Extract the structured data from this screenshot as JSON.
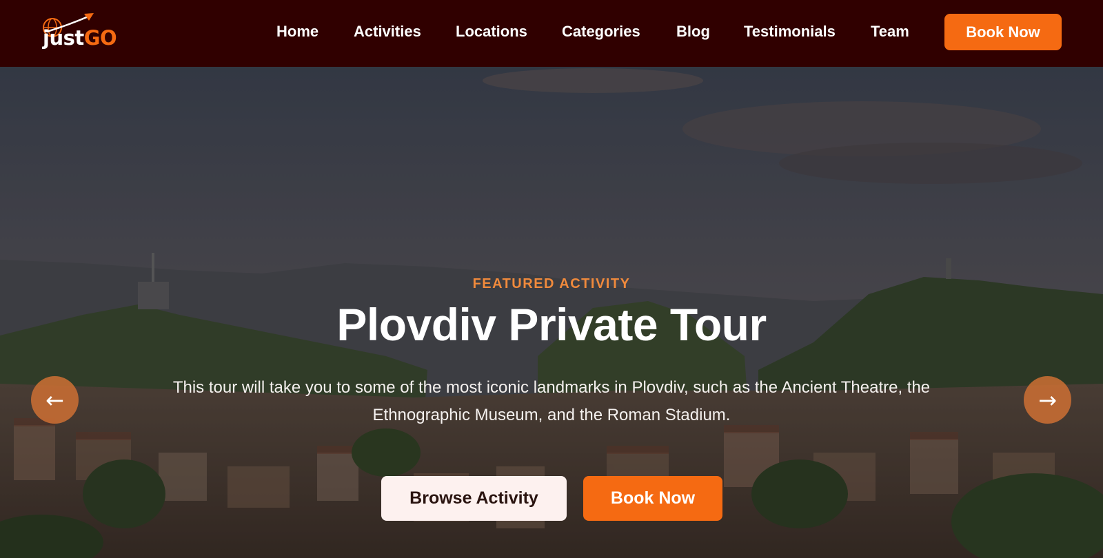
{
  "brand": {
    "name_part1": "just",
    "name_part2": "GO",
    "accent_color": "#f56a12",
    "logo_icon": "globe-arrow-icon"
  },
  "nav": {
    "items": [
      {
        "label": "Home"
      },
      {
        "label": "Activities"
      },
      {
        "label": "Locations"
      },
      {
        "label": "Categories"
      },
      {
        "label": "Blog"
      },
      {
        "label": "Testimonials"
      },
      {
        "label": "Team"
      }
    ],
    "cta_label": "Book Now"
  },
  "hero": {
    "eyebrow": "FEATURED ACTIVITY",
    "title": "Plovdiv Private Tour",
    "description": "This tour will take you to some of the most iconic landmarks in Plovdiv, such as the Ancient Theatre, the Ethnographic Museum, and the Roman Stadium.",
    "primary_button": "Browse Activity",
    "secondary_button": "Book Now",
    "prev_icon": "arrow-left-icon",
    "next_icon": "arrow-right-icon",
    "prev_glyph": "←",
    "next_glyph": "→"
  },
  "colors": {
    "navbar_bg": "#300000",
    "eyebrow": "#f08a3c",
    "secondary_button_bg": "#fdf1ef"
  }
}
